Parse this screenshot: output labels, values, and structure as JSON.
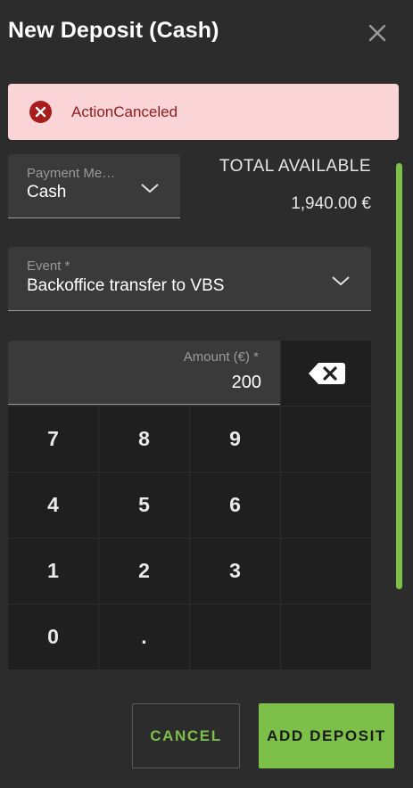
{
  "dialog": {
    "title": "New Deposit (Cash)"
  },
  "alert": {
    "message": "ActionCanceled"
  },
  "payment_method": {
    "label": "Payment Me…",
    "value": "Cash"
  },
  "total": {
    "label": "TOTAL AVAILABLE",
    "value": "1,940.00 €"
  },
  "event": {
    "label": "Event *",
    "value": "Backoffice transfer to VBS"
  },
  "amount": {
    "label": "Amount (€) *",
    "value": "200"
  },
  "keypad": {
    "keys": [
      "7",
      "8",
      "9",
      "4",
      "5",
      "6",
      "1",
      "2",
      "3",
      "0",
      "."
    ]
  },
  "actions": {
    "cancel_label": "CANCEL",
    "add_label": "ADD DEPOSIT"
  },
  "colors": {
    "background": "#2c2c2c",
    "accent": "#7cc04a",
    "alert_bg": "#fad4d6",
    "alert_text": "#8b1d1d",
    "error_icon": "#a81c1c"
  },
  "icons": {
    "close": "close-icon",
    "alert": "error-circle-icon",
    "dropdown": "chevron-down-icon",
    "backspace": "backspace-icon"
  }
}
